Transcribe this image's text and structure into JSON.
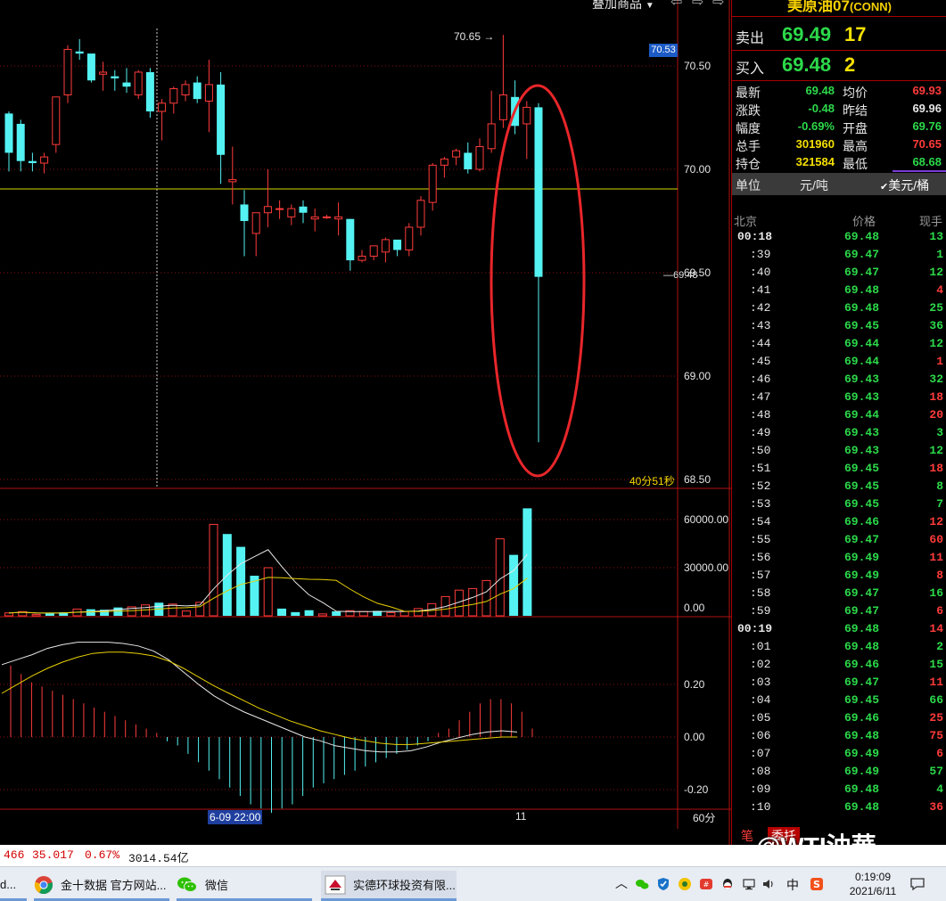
{
  "toolbar": {
    "overlay_label": "叠加商品",
    "dropdown_arrow": "▼",
    "nav_left": "⇦",
    "nav_right": "⇨"
  },
  "instrument": {
    "title": "美原油07",
    "code": "(CONN)"
  },
  "quote": {
    "ask_label": "卖出",
    "ask_price": "69.49",
    "ask_qty": "17",
    "bid_label": "买入",
    "bid_price": "69.48",
    "bid_qty": "2",
    "stats": [
      {
        "l1": "最新",
        "v1": "69.48",
        "c1": "green",
        "l2": "均价",
        "v2": "69.93",
        "c2": "red"
      },
      {
        "l1": "涨跌",
        "v1": "-0.48",
        "c1": "green",
        "l2": "昨结",
        "v2": "69.96",
        "c2": "white"
      },
      {
        "l1": "幅度",
        "v1": "-0.69%",
        "c1": "green",
        "l2": "开盘",
        "v2": "69.76",
        "c2": "green"
      },
      {
        "l1": "总手",
        "v1": "301960",
        "c1": "yellow",
        "l2": "最高",
        "v2": "70.65",
        "c2": "red"
      },
      {
        "l1": "持仓",
        "v1": "321584",
        "c1": "yellow",
        "l2": "最低",
        "v2": "68.68",
        "c2": "green"
      }
    ],
    "unit_label": "单位",
    "unit_option1": "元/吨",
    "unit_option2": "美元/桶",
    "unit_check": "✔"
  },
  "ticks": {
    "headers": {
      "time": "北京",
      "price": "价格",
      "qty": "现手"
    },
    "rows": [
      {
        "t": "00:18",
        "p": "69.48",
        "q": "13",
        "qc": "green"
      },
      {
        "t": ":39",
        "p": "69.47",
        "q": "1",
        "qc": "green"
      },
      {
        "t": ":40",
        "p": "69.47",
        "q": "12",
        "qc": "green"
      },
      {
        "t": ":41",
        "p": "69.48",
        "q": "4",
        "qc": "red"
      },
      {
        "t": ":42",
        "p": "69.48",
        "q": "25",
        "qc": "green"
      },
      {
        "t": ":43",
        "p": "69.45",
        "q": "36",
        "qc": "green"
      },
      {
        "t": ":44",
        "p": "69.44",
        "q": "12",
        "qc": "green"
      },
      {
        "t": ":45",
        "p": "69.44",
        "q": "1",
        "qc": "red"
      },
      {
        "t": ":46",
        "p": "69.43",
        "q": "32",
        "qc": "green"
      },
      {
        "t": ":47",
        "p": "69.43",
        "q": "18",
        "qc": "red"
      },
      {
        "t": ":48",
        "p": "69.44",
        "q": "20",
        "qc": "red"
      },
      {
        "t": ":49",
        "p": "69.43",
        "q": "3",
        "qc": "green"
      },
      {
        "t": ":50",
        "p": "69.43",
        "q": "12",
        "qc": "green"
      },
      {
        "t": ":51",
        "p": "69.45",
        "q": "18",
        "qc": "red"
      },
      {
        "t": ":52",
        "p": "69.45",
        "q": "8",
        "qc": "green"
      },
      {
        "t": ":53",
        "p": "69.45",
        "q": "7",
        "qc": "green"
      },
      {
        "t": ":54",
        "p": "69.46",
        "q": "12",
        "qc": "red"
      },
      {
        "t": ":55",
        "p": "69.47",
        "q": "60",
        "qc": "red"
      },
      {
        "t": ":56",
        "p": "69.49",
        "q": "11",
        "qc": "red"
      },
      {
        "t": ":57",
        "p": "69.49",
        "q": "8",
        "qc": "red"
      },
      {
        "t": ":58",
        "p": "69.47",
        "q": "16",
        "qc": "green"
      },
      {
        "t": ":59",
        "p": "69.47",
        "q": "6",
        "qc": "red"
      },
      {
        "t": "00:19",
        "p": "69.48",
        "q": "14",
        "qc": "red"
      },
      {
        "t": ":01",
        "p": "69.48",
        "q": "2",
        "qc": "green"
      },
      {
        "t": ":02",
        "p": "69.46",
        "q": "15",
        "qc": "green"
      },
      {
        "t": ":03",
        "p": "69.47",
        "q": "11",
        "qc": "red"
      },
      {
        "t": ":04",
        "p": "69.45",
        "q": "66",
        "qc": "green"
      },
      {
        "t": ":05",
        "p": "69.46",
        "q": "25",
        "qc": "red"
      },
      {
        "t": ":06",
        "p": "69.48",
        "q": "75",
        "qc": "red"
      },
      {
        "t": ":07",
        "p": "69.49",
        "q": "6",
        "qc": "red"
      },
      {
        "t": ":08",
        "p": "69.49",
        "q": "57",
        "qc": "green"
      },
      {
        "t": ":09",
        "p": "69.48",
        "q": "4",
        "qc": "green"
      },
      {
        "t": ":10",
        "p": "69.48",
        "q": "36",
        "qc": "red"
      }
    ],
    "tab1": "笔",
    "tab2": "委托"
  },
  "watermark": "@WTI油華",
  "chart": {
    "price_axis": [
      "70.50",
      "70.00",
      "69.50",
      "69.00",
      "68.50"
    ],
    "price_axis_values": [
      70.5,
      70.0,
      69.5,
      69.0,
      68.5
    ],
    "high_marker": "70.65",
    "current_price_tag": "70.53",
    "last_price_label": "69.48",
    "countdown": "40分51秒",
    "volume_axis": [
      "60000.00",
      "30000.00",
      "0.00"
    ],
    "macd_axis": [
      "0.20",
      "0.00",
      "-0.20"
    ],
    "date_label": "6-09 22:00",
    "time_label_11": "11",
    "period_label": "60分",
    "colors": {
      "up": "#ff3b3b",
      "down": "#54f2f2",
      "ma_white": "#e8e8e8",
      "ma_yellow": "#e8d000",
      "grid": "#8a1010",
      "ref_line": "#d8d800",
      "highlight": "#e8262a"
    }
  },
  "chart_data": {
    "type": "candlestick",
    "ohlc": [
      {
        "o": 70.27,
        "h": 70.28,
        "l": 69.99,
        "c": 70.08
      },
      {
        "o": 70.22,
        "h": 70.24,
        "l": 69.99,
        "c": 70.04
      },
      {
        "o": 70.04,
        "h": 70.08,
        "l": 69.99,
        "c": 70.03
      },
      {
        "o": 70.03,
        "h": 70.08,
        "l": 69.98,
        "c": 70.06
      },
      {
        "o": 70.12,
        "h": 70.33,
        "l": 70.08,
        "c": 70.35
      },
      {
        "o": 70.36,
        "h": 70.6,
        "l": 70.32,
        "c": 70.58
      },
      {
        "o": 70.57,
        "h": 70.63,
        "l": 70.53,
        "c": 70.56
      },
      {
        "o": 70.56,
        "h": 70.53,
        "l": 70.42,
        "c": 70.43
      },
      {
        "o": 70.46,
        "h": 70.52,
        "l": 70.38,
        "c": 70.47
      },
      {
        "o": 70.45,
        "h": 70.48,
        "l": 70.38,
        "c": 70.44
      },
      {
        "o": 70.42,
        "h": 70.49,
        "l": 70.37,
        "c": 70.4
      },
      {
        "o": 70.36,
        "h": 70.48,
        "l": 70.34,
        "c": 70.47
      },
      {
        "o": 70.47,
        "h": 70.49,
        "l": 70.25,
        "c": 70.28
      },
      {
        "o": 70.28,
        "h": 70.34,
        "l": 70.14,
        "c": 70.32
      },
      {
        "o": 70.32,
        "h": 70.4,
        "l": 70.27,
        "c": 70.39
      },
      {
        "o": 70.36,
        "h": 70.43,
        "l": 70.33,
        "c": 70.41
      },
      {
        "o": 70.42,
        "h": 70.45,
        "l": 70.32,
        "c": 70.34
      },
      {
        "o": 70.33,
        "h": 70.53,
        "l": 70.18,
        "c": 70.41
      },
      {
        "o": 70.41,
        "h": 70.47,
        "l": 69.93,
        "c": 70.07
      },
      {
        "o": 69.94,
        "h": 70.11,
        "l": 69.83,
        "c": 69.95
      },
      {
        "o": 69.83,
        "h": 69.9,
        "l": 69.58,
        "c": 69.75
      },
      {
        "o": 69.69,
        "h": 69.78,
        "l": 69.58,
        "c": 69.79
      },
      {
        "o": 69.79,
        "h": 70.0,
        "l": 69.72,
        "c": 69.82
      },
      {
        "o": 69.81,
        "h": 69.85,
        "l": 69.76,
        "c": 69.81
      },
      {
        "o": 69.77,
        "h": 69.83,
        "l": 69.73,
        "c": 69.81
      },
      {
        "o": 69.82,
        "h": 69.85,
        "l": 69.74,
        "c": 69.79
      },
      {
        "o": 69.76,
        "h": 69.81,
        "l": 69.7,
        "c": 69.77
      },
      {
        "o": 69.77,
        "h": 69.78,
        "l": 69.76,
        "c": 69.77
      },
      {
        "o": 69.76,
        "h": 69.84,
        "l": 69.68,
        "c": 69.77
      },
      {
        "o": 69.76,
        "h": 69.76,
        "l": 69.51,
        "c": 69.56
      },
      {
        "o": 69.56,
        "h": 69.61,
        "l": 69.55,
        "c": 69.58
      },
      {
        "o": 69.58,
        "h": 69.63,
        "l": 69.56,
        "c": 69.63
      },
      {
        "o": 69.6,
        "h": 69.67,
        "l": 69.55,
        "c": 69.66
      },
      {
        "o": 69.66,
        "h": 69.65,
        "l": 69.58,
        "c": 69.61
      },
      {
        "o": 69.61,
        "h": 69.74,
        "l": 69.58,
        "c": 69.72
      },
      {
        "o": 69.72,
        "h": 69.87,
        "l": 69.68,
        "c": 69.85
      },
      {
        "o": 69.84,
        "h": 70.03,
        "l": 69.8,
        "c": 70.02
      },
      {
        "o": 70.02,
        "h": 70.06,
        "l": 69.96,
        "c": 70.05
      },
      {
        "o": 70.06,
        "h": 70.1,
        "l": 70.02,
        "c": 70.09
      },
      {
        "o": 70.08,
        "h": 70.13,
        "l": 69.98,
        "c": 70.0
      },
      {
        "o": 70.0,
        "h": 70.15,
        "l": 69.99,
        "c": 70.11
      },
      {
        "o": 70.1,
        "h": 70.38,
        "l": 70.08,
        "c": 70.22
      },
      {
        "o": 70.24,
        "h": 70.65,
        "l": 70.2,
        "c": 70.36
      },
      {
        "o": 70.35,
        "h": 70.43,
        "l": 70.17,
        "c": 70.21
      },
      {
        "o": 70.22,
        "h": 70.33,
        "l": 70.05,
        "c": 70.3
      },
      {
        "o": 70.3,
        "h": 70.32,
        "l": 68.68,
        "c": 69.48
      }
    ],
    "volume": [
      1800,
      2600,
      900,
      1500,
      2200,
      4200,
      4100,
      3800,
      5200,
      5600,
      6800,
      8200,
      7300,
      3000,
      8400,
      57000,
      51000,
      43000,
      25000,
      30000,
      4500,
      2300,
      3500,
      1200,
      2800,
      3200,
      2700,
      3100,
      2000,
      2700,
      4500,
      7600,
      12000,
      16000,
      17000,
      22000,
      48000,
      38000,
      67000
    ],
    "volume_color": [
      "u",
      "u",
      "u",
      "d",
      "d",
      "u",
      "d",
      "d",
      "d",
      "u",
      "u",
      "d",
      "u",
      "u",
      "u",
      "u",
      "d",
      "d",
      "d",
      "u",
      "d",
      "d",
      "d",
      "u",
      "d",
      "u",
      "u",
      "d",
      "u",
      "u",
      "u",
      "u",
      "u",
      "u",
      "u",
      "u",
      "u",
      "d",
      "d",
      "d"
    ],
    "macd_hist": [
      0.17,
      0.15,
      0.13,
      0.12,
      0.11,
      0.1,
      0.09,
      0.08,
      0.07,
      0.06,
      0.05,
      0.04,
      0.03,
      0.02,
      0.01,
      -0.01,
      -0.02,
      -0.04,
      -0.06,
      -0.08,
      -0.1,
      -0.12,
      -0.14,
      -0.16,
      -0.17,
      -0.18,
      -0.17,
      -0.16,
      -0.14,
      -0.12,
      -0.11,
      -0.1,
      -0.09,
      -0.08,
      -0.07,
      -0.06,
      -0.05,
      -0.04,
      -0.03,
      -0.02,
      -0.01,
      0.01,
      0.02,
      0.04,
      0.06,
      0.08,
      0.09,
      0.09,
      0.08,
      0.06,
      0.02
    ],
    "y_axis_label": "",
    "period": "60分"
  },
  "bottom_bar": {
    "v1": "466",
    "v2": "35.017",
    "v3": "0.67%",
    "v4": "3014.54亿"
  },
  "taskbar": {
    "cut_label": "d...",
    "chrome_label": "金十数据 官方网站...",
    "wechat_label": "微信",
    "app_label": "实德环球投资有限...",
    "ime_label": "中",
    "time": "0:19:09",
    "date": "2021/6/11"
  }
}
